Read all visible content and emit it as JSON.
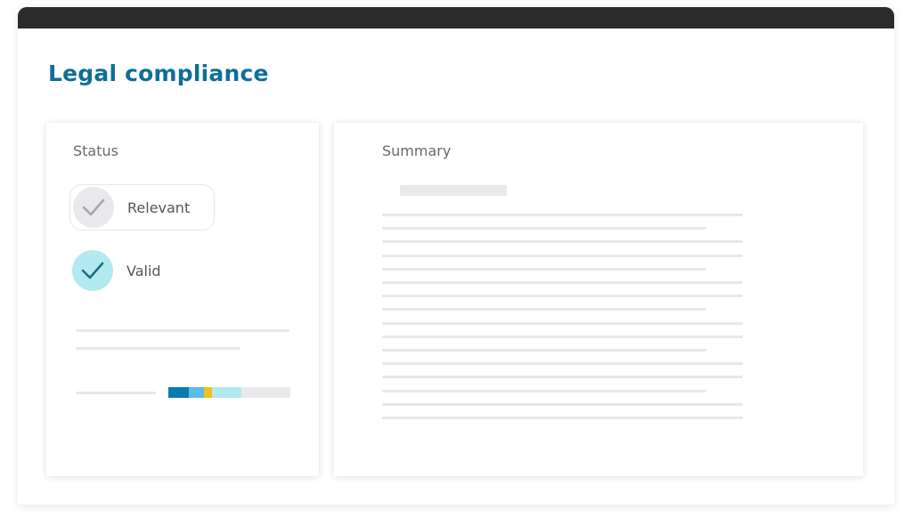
{
  "page": {
    "title": "Legal compliance"
  },
  "status_panel": {
    "heading": "Status",
    "options": [
      {
        "label": "Relevant",
        "state": "unchecked",
        "icon": "check-icon",
        "color": "#e9e9ec"
      },
      {
        "label": "Valid",
        "state": "checked",
        "icon": "check-icon",
        "color": "#b3e9f0"
      }
    ],
    "progress_segments": [
      {
        "color": "#0a7bb0",
        "fraction": 0.17
      },
      {
        "color": "#5bbde6",
        "fraction": 0.12
      },
      {
        "color": "#f2c01c",
        "fraction": 0.07
      },
      {
        "color": "#b3e9f0",
        "fraction": 0.24
      },
      {
        "color": "#e9e9ec",
        "fraction": 0.4
      }
    ]
  },
  "summary_panel": {
    "heading": "Summary"
  },
  "colors": {
    "title": "#0f6e9a",
    "titlebar": "#2b2b2b",
    "placeholder": "#e8e8eb"
  }
}
